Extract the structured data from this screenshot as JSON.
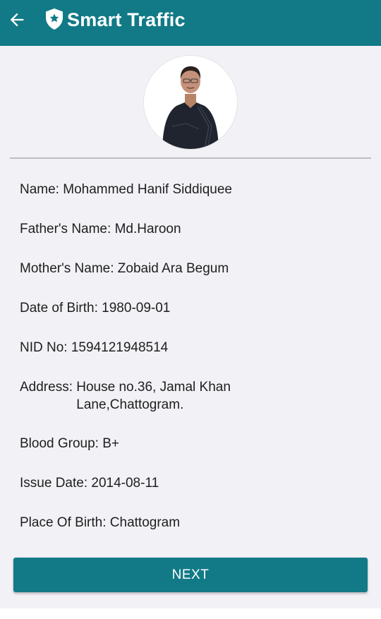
{
  "app_bar": {
    "title": "Smart Traffic",
    "back_icon": "arrow-left-icon",
    "logo_icon": "shield-star-icon",
    "color": "#117a86"
  },
  "profile": {
    "photo_icon": "person-photo"
  },
  "fields": [
    {
      "label": "Name: ",
      "value": "Mohammed Hanif Siddiquee"
    },
    {
      "label": "Father's Name: ",
      "value": "Md.Haroon"
    },
    {
      "label": "Mother's Name: ",
      "value": "Zobaid Ara Begum"
    },
    {
      "label": "Date of Birth: ",
      "value": "1980-09-01"
    },
    {
      "label": "NID No: ",
      "value": "1594121948514"
    },
    {
      "label": "Address: ",
      "value": "House no.36, Jamal Khan\nLane,Chattogram."
    },
    {
      "label": "Blood Group: ",
      "value": "B+"
    },
    {
      "label": "Issue Date: ",
      "value": "2014-08-11"
    },
    {
      "label": "Place Of Birth: ",
      "value": "Chattogram"
    }
  ],
  "actions": {
    "next_label": "NEXT"
  }
}
